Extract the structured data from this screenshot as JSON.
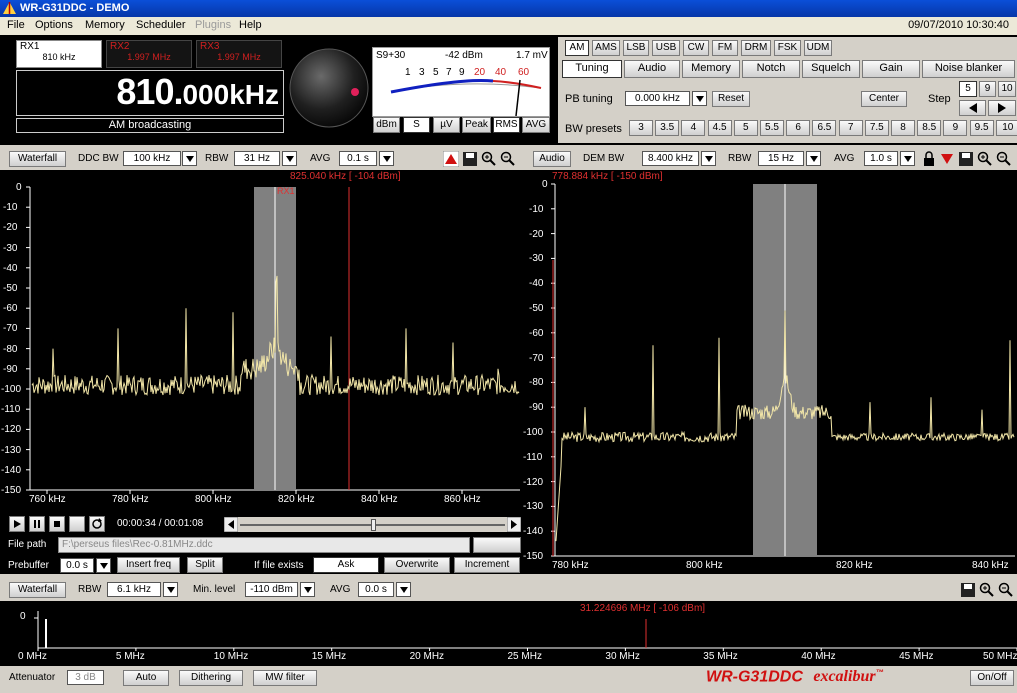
{
  "window": {
    "title": "WR-G31DDC - DEMO",
    "datetime": "09/07/2010 10:30:40"
  },
  "menu": [
    {
      "label": "File",
      "disabled": false
    },
    {
      "label": "Options",
      "disabled": false
    },
    {
      "label": "Memory",
      "disabled": false
    },
    {
      "label": "Scheduler",
      "disabled": false
    },
    {
      "label": "Plugins",
      "disabled": true
    },
    {
      "label": "Help",
      "disabled": false
    }
  ],
  "receivers": [
    {
      "name": "RX1",
      "freq": "810 kHz",
      "active": true
    },
    {
      "name": "RX2",
      "freq": "1.997 MHz",
      "active": false
    },
    {
      "name": "RX3",
      "freq": "1.997 MHz",
      "active": false
    }
  ],
  "display": {
    "freq_main": "810.",
    "freq_fine": "000",
    "unit": "kHz",
    "description": "AM broadcasting"
  },
  "smeter": {
    "label_s": "S9+30",
    "dbm": "-42 dBm",
    "mv": "1.7 mV",
    "scale": [
      "1",
      "3",
      "5",
      "7",
      "9",
      "20",
      "40",
      "60"
    ],
    "level_fraction": 0.86,
    "buttons": [
      "dBm",
      "S",
      "µV",
      "Peak",
      "RMS",
      "AVG"
    ],
    "selected": [
      "S",
      "RMS"
    ]
  },
  "modes": [
    "AM",
    "AMS",
    "LSB",
    "USB",
    "CW",
    "FM",
    "DRM",
    "FSK",
    "UDM"
  ],
  "selected_mode": "AM",
  "tabs": [
    "Tuning",
    "Audio",
    "Memory",
    "Notch",
    "Squelch",
    "Gain",
    "Noise blanker"
  ],
  "selected_tab": "Tuning",
  "tuning": {
    "pb_label": "PB tuning",
    "pb_value": "0.000 kHz",
    "reset": "Reset",
    "center": "Center",
    "step_label": "Step",
    "steps": [
      "5",
      "9",
      "10"
    ],
    "selected_step": "5",
    "bw_label": "BW presets",
    "bw_presets": [
      "3",
      "3.5",
      "4",
      "4.5",
      "5",
      "5.5",
      "6",
      "6.5",
      "7",
      "7.5",
      "8",
      "8.5",
      "9",
      "9.5",
      "10"
    ]
  },
  "ddc_panel": {
    "mode_btn": "Waterfall",
    "bw_label": "DDC BW",
    "bw_value": "100 kHz",
    "rbw_label": "RBW",
    "rbw_value": "31 Hz",
    "avg_label": "AVG",
    "avg_value": "0.1 s",
    "cursor": "825.040 kHz [ -104 dBm]",
    "marker": "RX1",
    "y_ticks": [
      "0",
      "-10",
      "-20",
      "-30",
      "-40",
      "-50",
      "-60",
      "-70",
      "-80",
      "-90",
      "-100",
      "-110",
      "-120",
      "-130",
      "-140",
      "-150"
    ],
    "x_ticks": [
      "760 kHz",
      "780 kHz",
      "800 kHz",
      "820 kHz",
      "840 kHz",
      "860 kHz"
    ]
  },
  "audio_panel": {
    "mode_btn": "Audio",
    "bw_label": "DEM BW",
    "bw_value": "8.400 kHz",
    "rbw_label": "RBW",
    "rbw_value": "15 Hz",
    "avg_label": "AVG",
    "avg_value": "1.0 s",
    "cursor": "778.884 kHz [ -150 dBm]",
    "y_ticks": [
      "0",
      "-10",
      "-20",
      "-30",
      "-40",
      "-50",
      "-60",
      "-70",
      "-80",
      "-90",
      "-100",
      "-110",
      "-120",
      "-130",
      "-140",
      "-150"
    ],
    "x_ticks": [
      "780 kHz",
      "800 kHz",
      "820 kHz",
      "840 kHz"
    ]
  },
  "player": {
    "time": "00:00:34 / 00:01:08",
    "progress": 0.5,
    "file_label": "File path",
    "file_value": "F:\\perseus files\\Rec-0.81MHz.ddc",
    "prebuffer_label": "Prebuffer",
    "prebuffer_value": "0.0 s",
    "insert_freq": "Insert freq",
    "split": "Split",
    "if_exists_label": "If file exists",
    "ask": "Ask",
    "overwrite": "Overwrite",
    "increment": "Increment"
  },
  "wideband": {
    "mode_btn": "Waterfall",
    "rbw_label": "RBW",
    "rbw_value": "6.1 kHz",
    "min_label": "Min. level",
    "min_value": "-110 dBm",
    "avg_label": "AVG",
    "avg_value": "0.0 s",
    "cursor": "31.224696 MHz [ -106 dBm]",
    "y_tick": "0",
    "x_ticks": [
      "0 MHz",
      "5 MHz",
      "10 MHz",
      "15 MHz",
      "20 MHz",
      "25 MHz",
      "30 MHz",
      "35 MHz",
      "40 MHz",
      "45 MHz",
      "50 MHz"
    ]
  },
  "statusbar": {
    "attenuator_label": "Attenuator",
    "attenuator_value": "3 dB",
    "auto": "Auto",
    "dithering": "Dithering",
    "mw_filter": "MW filter",
    "brand": "WR-G31DDC",
    "brand_sub": "excalibur",
    "brand_tm": "™",
    "power": "On/Off"
  },
  "colors": {
    "spectrum": "#f2e6a8",
    "cursor": "#e03030",
    "passband": "#808080",
    "brand": "#d01010"
  }
}
